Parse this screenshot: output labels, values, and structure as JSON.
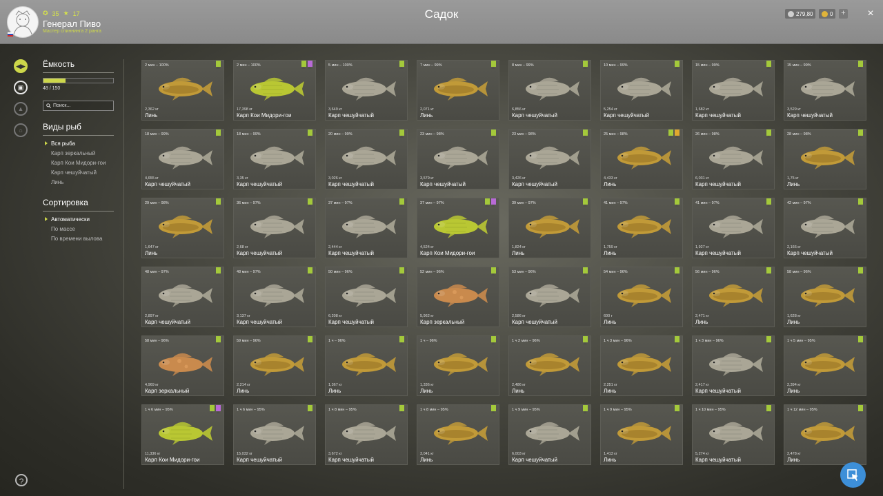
{
  "player": {
    "level": "35",
    "stars": "17",
    "name": "Генерал Пиво",
    "rank": "Мастер спиннинга 2 ранга"
  },
  "page_title": "Садок",
  "currency": {
    "silver": "279,80",
    "gold": "0",
    "plus_label": "+",
    "close_label": "×"
  },
  "capacity": {
    "title": "Ёмкость",
    "text": "48 / 150",
    "fraction": 0.32
  },
  "search": {
    "placeholder": "Поиск..."
  },
  "fish_filter": {
    "title": "Виды рыб",
    "options": [
      "Вся рыба",
      "Карп зеркальный",
      "Карп Кои Мидори-гои",
      "Карп чешуйчатый",
      "Линь"
    ],
    "selected": 0
  },
  "sort": {
    "title": "Сортировка",
    "options": [
      "Автоматически",
      "По массе",
      "По времени вылова"
    ],
    "selected": 0
  },
  "help_label": "?",
  "colors": {
    "accent": "#cdd74a",
    "bookmark_green": "#a4c93b",
    "bookmark_purple": "#b86ad6",
    "bookmark_gold": "#e0a82e",
    "koi": "#b9c733",
    "tench": "#c19a38",
    "common": "#aaa696",
    "mirror": "#c98a4d",
    "cursor_button": "#3d8fd8"
  },
  "fish": [
    {
      "time": "2 мин – 100%",
      "weight": "2,362 кг",
      "name": "Линь",
      "type": "tench",
      "marks": [
        "green"
      ]
    },
    {
      "time": "2 мин – 100%",
      "weight": "17,398 кг",
      "name": "Карп Кои Мидори-гои",
      "type": "koi",
      "marks": [
        "green",
        "purple"
      ]
    },
    {
      "time": "5 мин – 100%",
      "weight": "3,649 кг",
      "name": "Карп чешуйчатый",
      "type": "common",
      "marks": [
        "green"
      ]
    },
    {
      "time": "7 мин – 99%",
      "weight": "2,071 кг",
      "name": "Линь",
      "type": "tench",
      "marks": [
        "green"
      ]
    },
    {
      "time": "8 мин – 99%",
      "weight": "6,856 кг",
      "name": "Карп чешуйчатый",
      "type": "common",
      "marks": [
        "green"
      ]
    },
    {
      "time": "10 мин – 99%",
      "weight": "5,254 кг",
      "name": "Карп чешуйчатый",
      "type": "common",
      "marks": [
        "green"
      ]
    },
    {
      "time": "15 мин – 99%",
      "weight": "1,682 кг",
      "name": "Карп чешуйчатый",
      "type": "common",
      "marks": [
        "green"
      ]
    },
    {
      "time": "15 мин – 99%",
      "weight": "3,529 кг",
      "name": "Карп чешуйчатый",
      "type": "common",
      "marks": [
        "green"
      ]
    },
    {
      "time": "18 мин – 99%",
      "weight": "4,655 кг",
      "name": "Карп чешуйчатый",
      "type": "common",
      "marks": [
        "green"
      ]
    },
    {
      "time": "18 мин – 99%",
      "weight": "3,35 кг",
      "name": "Карп чешуйчатый",
      "type": "common",
      "marks": [
        "green"
      ]
    },
    {
      "time": "20 мин – 99%",
      "weight": "3,026 кг",
      "name": "Карп чешуйчатый",
      "type": "common",
      "marks": [
        "green"
      ]
    },
    {
      "time": "23 мин – 98%",
      "weight": "3,579 кг",
      "name": "Карп чешуйчатый",
      "type": "common",
      "marks": [
        "green"
      ]
    },
    {
      "time": "23 мин – 98%",
      "weight": "3,426 кг",
      "name": "Карп чешуйчатый",
      "type": "common",
      "marks": [
        "green"
      ]
    },
    {
      "time": "25 мин – 98%",
      "weight": "4,433 кг",
      "name": "Линь",
      "type": "tench",
      "marks": [
        "green",
        "gold"
      ]
    },
    {
      "time": "26 мин – 98%",
      "weight": "6,031 кг",
      "name": "Карп чешуйчатый",
      "type": "common",
      "marks": [
        "green"
      ]
    },
    {
      "time": "28 мин – 98%",
      "weight": "1,75 кг",
      "name": "Линь",
      "type": "tench",
      "marks": [
        "green"
      ]
    },
    {
      "time": "29 мин – 98%",
      "weight": "1,647 кг",
      "name": "Линь",
      "type": "tench",
      "marks": [
        "green"
      ]
    },
    {
      "time": "36 мин – 97%",
      "weight": "2,68 кг",
      "name": "Карп чешуйчатый",
      "type": "common",
      "marks": [
        "green"
      ]
    },
    {
      "time": "37 мин – 97%",
      "weight": "2,444 кг",
      "name": "Карп чешуйчатый",
      "type": "common",
      "marks": [
        "green"
      ]
    },
    {
      "time": "37 мин – 97%",
      "weight": "4,524 кг",
      "name": "Карп Кои Мидори-гои",
      "type": "koi",
      "marks": [
        "green",
        "purple"
      ]
    },
    {
      "time": "39 мин – 97%",
      "weight": "1,824 кг",
      "name": "Линь",
      "type": "tench",
      "marks": [
        "green"
      ]
    },
    {
      "time": "41 мин – 97%",
      "weight": "1,759 кг",
      "name": "Линь",
      "type": "tench",
      "marks": [
        "green"
      ]
    },
    {
      "time": "41 мин – 97%",
      "weight": "1,927 кг",
      "name": "Карп чешуйчатый",
      "type": "common",
      "marks": [
        "green"
      ]
    },
    {
      "time": "42 мин – 97%",
      "weight": "2,166 кг",
      "name": "Карп чешуйчатый",
      "type": "common",
      "marks": [
        "green"
      ]
    },
    {
      "time": "48 мин – 97%",
      "weight": "2,897 кг",
      "name": "Карп чешуйчатый",
      "type": "common",
      "marks": [
        "green"
      ]
    },
    {
      "time": "48 мин – 97%",
      "weight": "3,137 кг",
      "name": "Карп чешуйчатый",
      "type": "common",
      "marks": [
        "green"
      ]
    },
    {
      "time": "50 мин – 96%",
      "weight": "6,208 кг",
      "name": "Карп чешуйчатый",
      "type": "common",
      "marks": [
        "green"
      ]
    },
    {
      "time": "52 мин – 96%",
      "weight": "5,962 кг",
      "name": "Карп зеркальный",
      "type": "mirror",
      "marks": [
        "green"
      ]
    },
    {
      "time": "53 мин – 96%",
      "weight": "2,586 кг",
      "name": "Карп чешуйчатый",
      "type": "common",
      "marks": [
        "green"
      ]
    },
    {
      "time": "54 мин – 96%",
      "weight": "600 г",
      "name": "Линь",
      "type": "tench",
      "marks": [
        "green"
      ]
    },
    {
      "time": "56 мин – 96%",
      "weight": "2,471 кг",
      "name": "Линь",
      "type": "tench",
      "marks": [
        "green"
      ]
    },
    {
      "time": "58 мин – 96%",
      "weight": "1,628 кг",
      "name": "Линь",
      "type": "tench",
      "marks": [
        "green"
      ]
    },
    {
      "time": "58 мин – 96%",
      "weight": "4,969 кг",
      "name": "Карп зеркальный",
      "type": "mirror",
      "marks": [
        "green"
      ]
    },
    {
      "time": "59 мин – 96%",
      "weight": "2,214 кг",
      "name": "Линь",
      "type": "tench",
      "marks": [
        "green"
      ]
    },
    {
      "time": "1 ч – 96%",
      "weight": "1,367 кг",
      "name": "Линь",
      "type": "tench",
      "marks": [
        "green"
      ]
    },
    {
      "time": "1 ч – 96%",
      "weight": "1,336 кг",
      "name": "Линь",
      "type": "tench",
      "marks": [
        "green"
      ]
    },
    {
      "time": "1 ч 2 мин – 96%",
      "weight": "2,486 кг",
      "name": "Линь",
      "type": "tench",
      "marks": [
        "green"
      ]
    },
    {
      "time": "1 ч 3 мин – 96%",
      "weight": "2,251 кг",
      "name": "Линь",
      "type": "tench",
      "marks": [
        "green"
      ]
    },
    {
      "time": "1 ч 3 мин – 96%",
      "weight": "2,417 кг",
      "name": "Карп чешуйчатый",
      "type": "common",
      "marks": [
        "green"
      ]
    },
    {
      "time": "1 ч 5 мин – 95%",
      "weight": "2,394 кг",
      "name": "Линь",
      "type": "tench",
      "marks": [
        "green"
      ]
    },
    {
      "time": "1 ч 6 мин – 95%",
      "weight": "11,336 кг",
      "name": "Карп Кои Мидори-гои",
      "type": "koi",
      "marks": [
        "green",
        "purple"
      ]
    },
    {
      "time": "1 ч 6 мин – 95%",
      "weight": "15,032 кг",
      "name": "Карп чешуйчатый",
      "type": "common",
      "marks": [
        "green"
      ]
    },
    {
      "time": "1 ч 8 мин – 95%",
      "weight": "3,672 кг",
      "name": "Карп чешуйчатый",
      "type": "common",
      "marks": [
        "green"
      ]
    },
    {
      "time": "1 ч 8 мин – 95%",
      "weight": "3,041 кг",
      "name": "Линь",
      "type": "tench",
      "marks": [
        "green"
      ]
    },
    {
      "time": "1 ч 9 мин – 95%",
      "weight": "6,003 кг",
      "name": "Карп чешуйчатый",
      "type": "common",
      "marks": [
        "green"
      ]
    },
    {
      "time": "1 ч 9 мин – 95%",
      "weight": "1,413 кг",
      "name": "Линь",
      "type": "tench",
      "marks": [
        "green"
      ]
    },
    {
      "time": "1 ч 10 мин – 95%",
      "weight": "5,274 кг",
      "name": "Карп чешуйчатый",
      "type": "common",
      "marks": [
        "green"
      ]
    },
    {
      "time": "1 ч 12 мин – 95%",
      "weight": "2,478 кг",
      "name": "Линь",
      "type": "tench",
      "marks": [
        "green"
      ]
    }
  ]
}
